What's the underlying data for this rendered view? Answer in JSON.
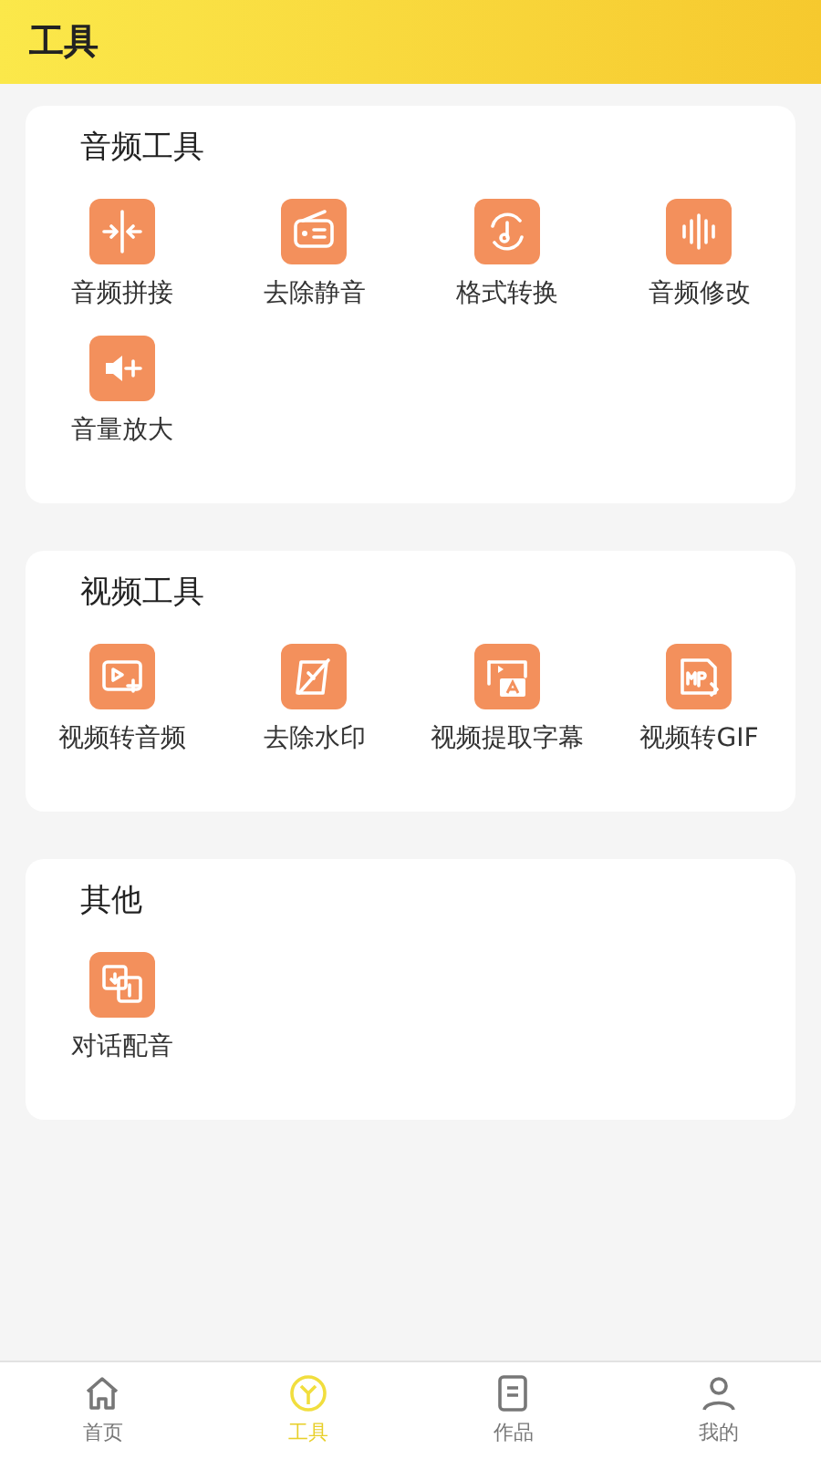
{
  "header": {
    "title": "工具"
  },
  "sections": [
    {
      "title": "音频工具",
      "tools": [
        {
          "label": "音频拼接"
        },
        {
          "label": "去除静音"
        },
        {
          "label": "格式转换"
        },
        {
          "label": "音频修改"
        },
        {
          "label": "音量放大"
        }
      ]
    },
    {
      "title": "视频工具",
      "tools": [
        {
          "label": "视频转音频"
        },
        {
          "label": "去除水印"
        },
        {
          "label": "视频提取字幕"
        },
        {
          "label": "视频转GIF"
        }
      ]
    },
    {
      "title": "其他",
      "tools": [
        {
          "label": "对话配音"
        }
      ]
    }
  ],
  "bottom_nav": [
    {
      "label": "首页",
      "selected": false
    },
    {
      "label": "工具",
      "selected": true
    },
    {
      "label": "作品",
      "selected": false
    },
    {
      "label": "我的",
      "selected": false
    }
  ]
}
